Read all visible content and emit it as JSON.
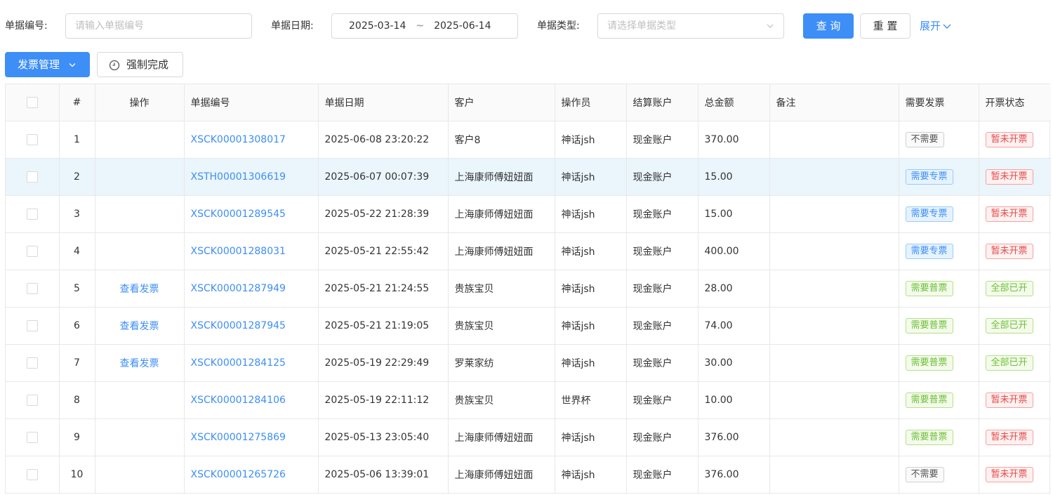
{
  "filters": {
    "doc_no_label": "单据编号:",
    "doc_no_placeholder": "请输入单据编号",
    "date_label": "单据日期:",
    "date_start": "2025-03-14",
    "date_sep": "~",
    "date_end": "2025-06-14",
    "type_label": "单据类型:",
    "type_placeholder": "请选择单据类型",
    "query_label": "查 询",
    "reset_label": "重 置",
    "expand_label": "展开"
  },
  "toolbar": {
    "invoice_mgmt_label": "发票管理",
    "force_complete_label": "强制完成"
  },
  "table": {
    "headers": {
      "index": "#",
      "action": "操作",
      "doc_no": "单据编号",
      "date": "单据日期",
      "customer": "客户",
      "operator": "操作员",
      "account": "结算账户",
      "amount": "总金额",
      "remark": "备注",
      "need_invoice": "需要发票",
      "invoice_status": "开票状态"
    },
    "rows": [
      {
        "index": "1",
        "action": "",
        "doc_no": "XSCK00001308017",
        "date": "2025-06-08 23:20:22",
        "customer": "客户8",
        "operator": "神话jsh",
        "account": "现金账户",
        "amount": "370.00",
        "remark": "",
        "need_invoice": "不需要",
        "need_type": "none",
        "invoice_status": "暂未开票",
        "status_type": "red"
      },
      {
        "index": "2",
        "action": "",
        "doc_no": "XSTH00001306619",
        "date": "2025-06-07 00:07:39",
        "customer": "上海康师傅妞妞面",
        "operator": "神话jsh",
        "account": "现金账户",
        "amount": "15.00",
        "remark": "",
        "need_invoice": "需要专票",
        "need_type": "blue",
        "invoice_status": "暂未开票",
        "status_type": "red"
      },
      {
        "index": "3",
        "action": "",
        "doc_no": "XSCK00001289545",
        "date": "2025-05-22 21:28:39",
        "customer": "上海康师傅妞妞面",
        "operator": "神话jsh",
        "account": "现金账户",
        "amount": "15.00",
        "remark": "",
        "need_invoice": "需要专票",
        "need_type": "blue",
        "invoice_status": "暂未开票",
        "status_type": "red"
      },
      {
        "index": "4",
        "action": "",
        "doc_no": "XSCK00001288031",
        "date": "2025-05-21 22:55:42",
        "customer": "上海康师傅妞妞面",
        "operator": "神话jsh",
        "account": "现金账户",
        "amount": "400.00",
        "remark": "",
        "need_invoice": "需要专票",
        "need_type": "blue",
        "invoice_status": "暂未开票",
        "status_type": "red"
      },
      {
        "index": "5",
        "action": "查看发票",
        "doc_no": "XSCK00001287949",
        "date": "2025-05-21 21:24:55",
        "customer": "贵族宝贝",
        "operator": "神话jsh",
        "account": "现金账户",
        "amount": "28.00",
        "remark": "",
        "need_invoice": "需要普票",
        "need_type": "green",
        "invoice_status": "全部已开",
        "status_type": "green"
      },
      {
        "index": "6",
        "action": "查看发票",
        "doc_no": "XSCK00001287945",
        "date": "2025-05-21 21:19:05",
        "customer": "贵族宝贝",
        "operator": "神话jsh",
        "account": "现金账户",
        "amount": "74.00",
        "remark": "",
        "need_invoice": "需要普票",
        "need_type": "green",
        "invoice_status": "全部已开",
        "status_type": "green"
      },
      {
        "index": "7",
        "action": "查看发票",
        "doc_no": "XSCK00001284125",
        "date": "2025-05-19 22:29:49",
        "customer": "罗莱家纺",
        "operator": "神话jsh",
        "account": "现金账户",
        "amount": "30.00",
        "remark": "",
        "need_invoice": "需要普票",
        "need_type": "green",
        "invoice_status": "全部已开",
        "status_type": "green"
      },
      {
        "index": "8",
        "action": "",
        "doc_no": "XSCK00001284106",
        "date": "2025-05-19 22:11:12",
        "customer": "贵族宝贝",
        "operator": "世界杯",
        "account": "现金账户",
        "amount": "10.00",
        "remark": "",
        "need_invoice": "需要普票",
        "need_type": "green",
        "invoice_status": "暂未开票",
        "status_type": "red"
      },
      {
        "index": "9",
        "action": "",
        "doc_no": "XSCK00001275869",
        "date": "2025-05-13 23:05:40",
        "customer": "上海康师傅妞妞面",
        "operator": "神话jsh",
        "account": "现金账户",
        "amount": "376.00",
        "remark": "",
        "need_invoice": "需要普票",
        "need_type": "green",
        "invoice_status": "暂未开票",
        "status_type": "red"
      },
      {
        "index": "10",
        "action": "",
        "doc_no": "XSCK00001265726",
        "date": "2025-05-06 13:39:01",
        "customer": "上海康师傅妞妞面",
        "operator": "神话jsh",
        "account": "现金账户",
        "amount": "376.00",
        "remark": "",
        "need_invoice": "不需要",
        "need_type": "none",
        "invoice_status": "暂未开票",
        "status_type": "red"
      }
    ],
    "highlighted_row": 2
  },
  "colors": {
    "primary": "#3d8ef6",
    "highlight_row": "#eaf5fc",
    "tag_red": "#e34b4b",
    "tag_green": "#6cbf3a",
    "tag_blue": "#3d8ef6"
  },
  "icons": {
    "select_chevron": "chevron-down-icon",
    "expand_chevron": "chevron-down-icon",
    "dropdown_chevron": "chevron-down-icon",
    "force_complete": "clock-icon"
  }
}
